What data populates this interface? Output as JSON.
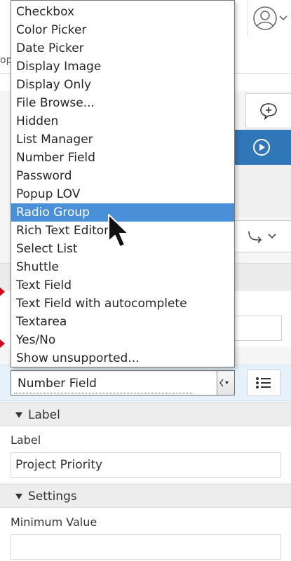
{
  "background": {
    "cut_text": "op"
  },
  "dropdown": {
    "items": [
      "Checkbox",
      "Color Picker",
      "Date Picker",
      "Display Image",
      "Display Only",
      "File Browse...",
      "Hidden",
      "List Manager",
      "Number Field",
      "Password",
      "Popup LOV",
      "Radio Group",
      "Rich Text Editor",
      "Select List",
      "Shuttle",
      "Text Field",
      "Text Field with autocomplete",
      "Textarea",
      "Yes/No",
      "Show unsupported..."
    ],
    "selected_index": 11
  },
  "type_select": {
    "value": "Number Field"
  },
  "label_group": {
    "title": "Label",
    "field_label": "Label",
    "field_value": "Project Priority"
  },
  "settings_group": {
    "title": "Settings",
    "field_label": "Minimum Value",
    "field_value": ""
  },
  "colors": {
    "accent": "#2f77b6",
    "selection": "#4a90d9",
    "required_marker": "#d0021b"
  },
  "icons": {
    "avatar": "user-circle-icon",
    "comment": "comment-add-icon",
    "run": "play-circle-icon",
    "shortcut": "redirect-arrow-icon",
    "list": "list-icon"
  }
}
